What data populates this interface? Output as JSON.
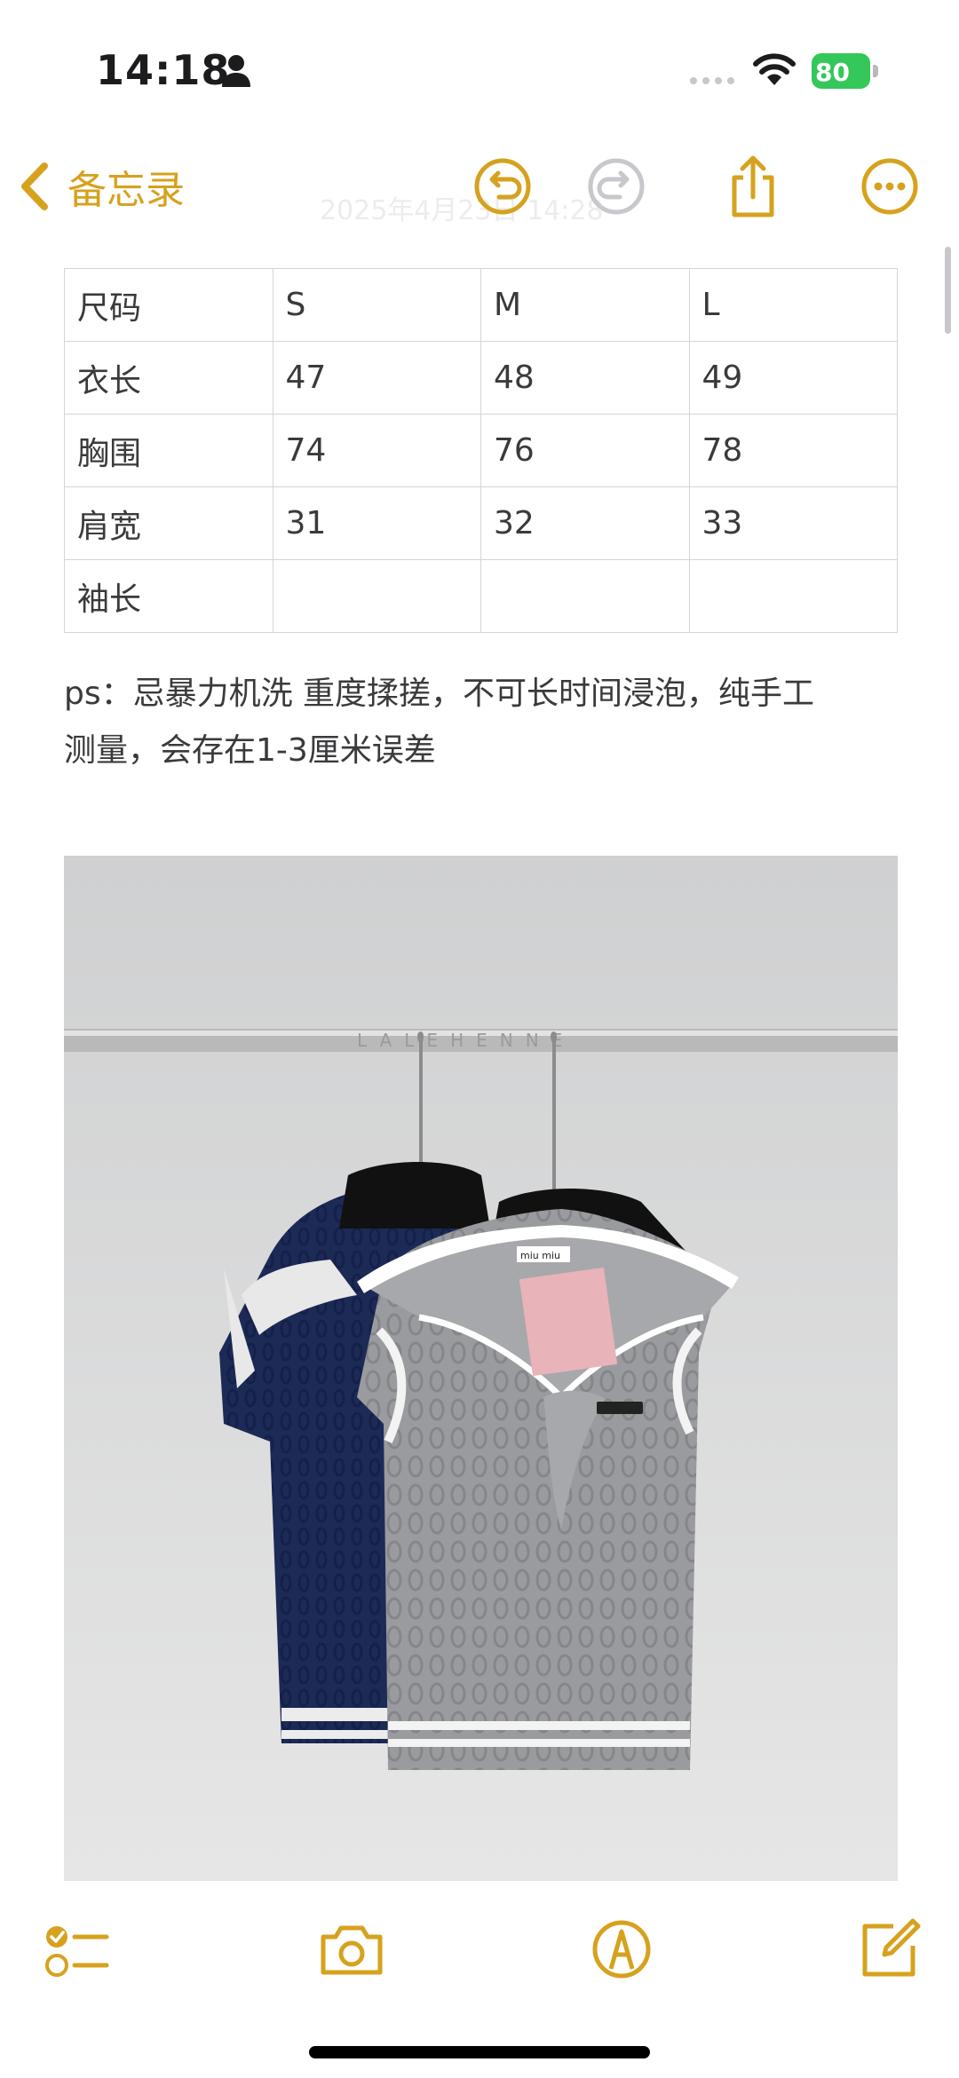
{
  "status_bar": {
    "time": "14:18",
    "battery": "80"
  },
  "nav": {
    "back_label": "备忘录",
    "ghost_date": "2025年4月23日 14:28"
  },
  "size_table": {
    "rows": [
      [
        "尺码",
        "S",
        "M",
        "L"
      ],
      [
        "衣长",
        "47",
        "48",
        "49"
      ],
      [
        "胸围",
        "74",
        "76",
        "78"
      ],
      [
        "肩宽",
        "31",
        "32",
        "33"
      ],
      [
        "袖长",
        "",
        "",
        ""
      ]
    ]
  },
  "note": {
    "line1": "ps：忌暴力机洗 重度揉搓，不可长时间浸泡，纯手工",
    "line2": "测量，会存在1-3厘米误差"
  },
  "photo": {
    "watermark": "LALEHENNE",
    "label_text": "miu miu"
  },
  "colors": {
    "accent": "#d6a21e",
    "battery": "#34c759"
  },
  "icons": [
    "person-icon",
    "signal-icon",
    "wifi-icon",
    "battery-icon",
    "back-chevron-icon",
    "undo-icon",
    "redo-icon",
    "share-icon",
    "more-icon",
    "checklist-icon",
    "camera-icon",
    "markup-icon",
    "compose-icon"
  ]
}
